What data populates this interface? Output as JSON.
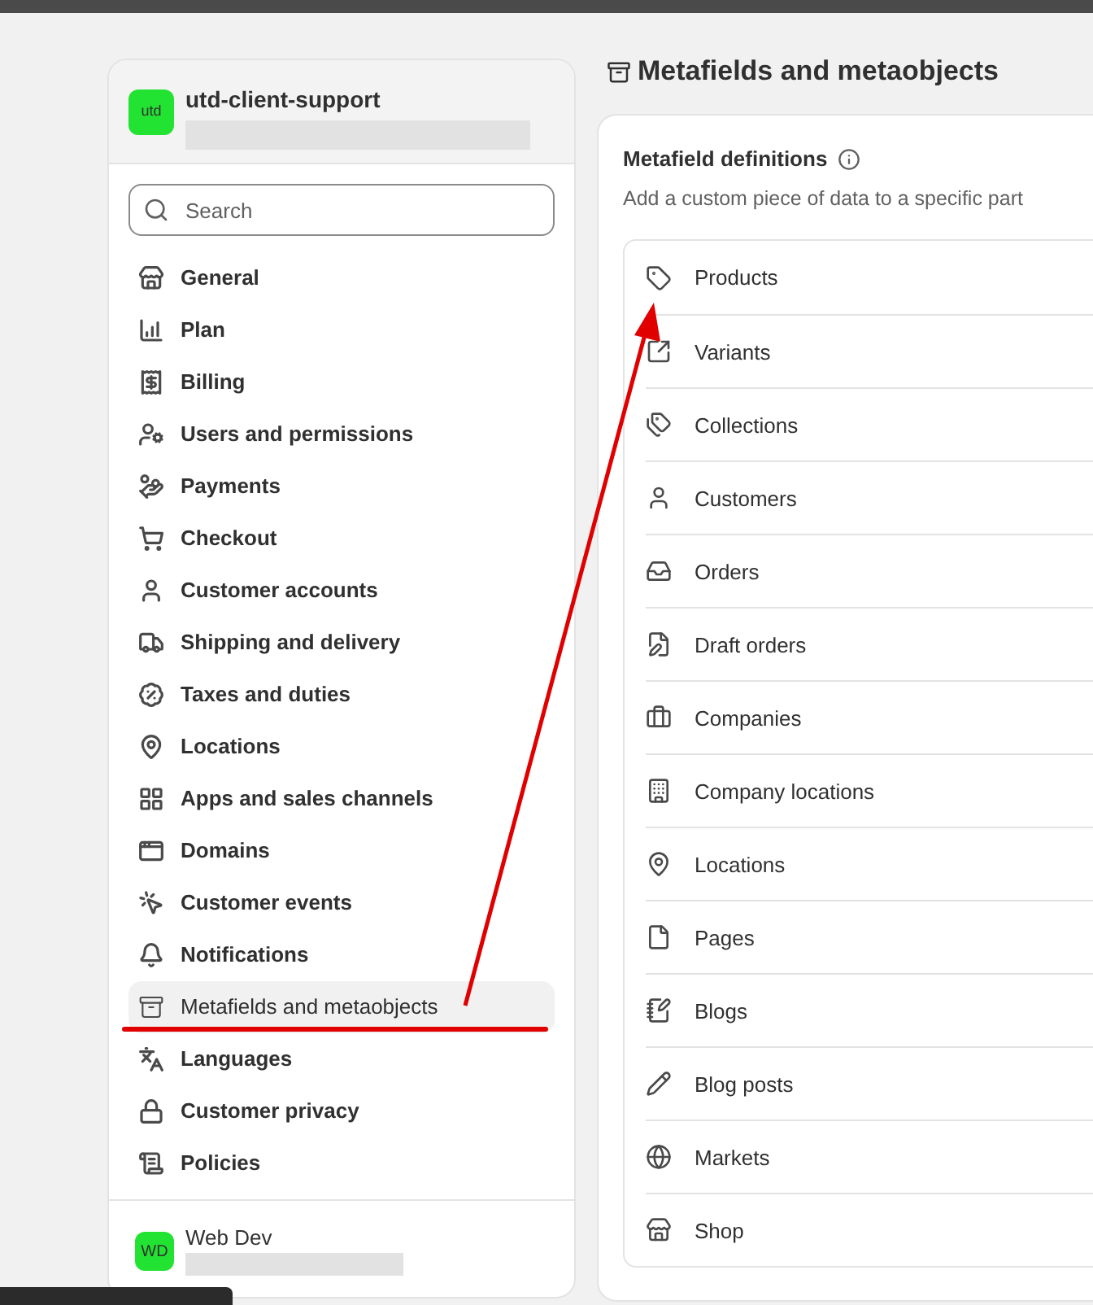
{
  "store": {
    "avatar": "utd",
    "name": "utd-client-support"
  },
  "search": {
    "placeholder": "Search"
  },
  "sidebar": {
    "items": [
      {
        "label": "General",
        "selected": false
      },
      {
        "label": "Plan",
        "selected": false
      },
      {
        "label": "Billing",
        "selected": false
      },
      {
        "label": "Users and permissions",
        "selected": false
      },
      {
        "label": "Payments",
        "selected": false
      },
      {
        "label": "Checkout",
        "selected": false
      },
      {
        "label": "Customer accounts",
        "selected": false
      },
      {
        "label": "Shipping and delivery",
        "selected": false
      },
      {
        "label": "Taxes and duties",
        "selected": false
      },
      {
        "label": "Locations",
        "selected": false
      },
      {
        "label": "Apps and sales channels",
        "selected": false
      },
      {
        "label": "Domains",
        "selected": false
      },
      {
        "label": "Customer events",
        "selected": false
      },
      {
        "label": "Notifications",
        "selected": false
      },
      {
        "label": "Metafields and metaobjects",
        "selected": true
      },
      {
        "label": "Languages",
        "selected": false
      },
      {
        "label": "Customer privacy",
        "selected": false
      },
      {
        "label": "Policies",
        "selected": false
      }
    ]
  },
  "user": {
    "avatar": "WD",
    "name": "Web Dev"
  },
  "page": {
    "title": "Metafields and metaobjects"
  },
  "card": {
    "heading": "Metafield definitions",
    "description": "Add a custom piece of data to a specific part",
    "rows": [
      {
        "label": "Products"
      },
      {
        "label": "Variants"
      },
      {
        "label": "Collections"
      },
      {
        "label": "Customers"
      },
      {
        "label": "Orders"
      },
      {
        "label": "Draft orders"
      },
      {
        "label": "Companies"
      },
      {
        "label": "Company locations"
      },
      {
        "label": "Locations"
      },
      {
        "label": "Pages"
      },
      {
        "label": "Blogs"
      },
      {
        "label": "Blog posts"
      },
      {
        "label": "Markets"
      },
      {
        "label": "Shop"
      }
    ]
  }
}
